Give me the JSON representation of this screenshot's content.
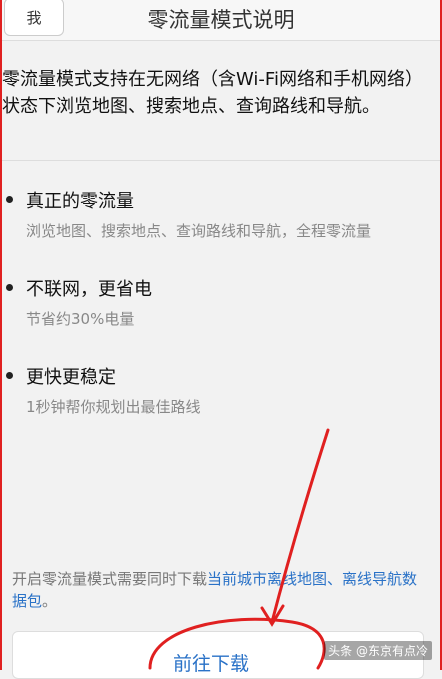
{
  "header": {
    "back_label": "我",
    "title": "零流量模式说明"
  },
  "intro": "零流量模式支持在无网络（含Wi-Fi网络和手机网络）状态下浏览地图、搜索地点、查询路线和导航。",
  "features": [
    {
      "title": "真正的零流量",
      "desc": "浏览地图、搜索地点、查询路线和导航，全程零流量"
    },
    {
      "title": "不联网，更省电",
      "desc": "节省约30%电量"
    },
    {
      "title": "更快更稳定",
      "desc": "1秒钟帮你规划出最佳路线"
    }
  ],
  "notice": {
    "text": "开启零流量模式需要同时下载",
    "link": "当前城市离线地图、离线导航数据包",
    "end": "。"
  },
  "download_label": "前往下载",
  "watermark": "头条 @东京有点冷",
  "colors": {
    "link": "#2a72c7",
    "annotation": "#e02020"
  }
}
